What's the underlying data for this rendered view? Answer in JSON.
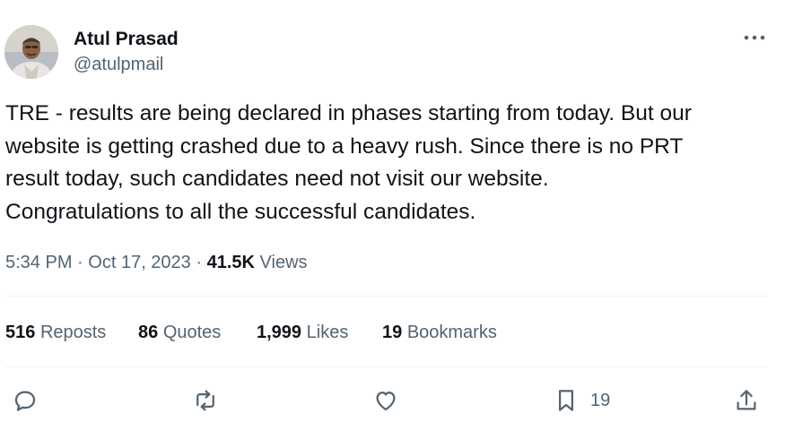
{
  "author": {
    "display_name": "Atul Prasad",
    "handle": "@atulpmail",
    "avatar_icon": "user-photo"
  },
  "tweet": {
    "text": "TRE - results are being declared in phases starting from today. But our\nwebsite is getting crashed due to a heavy rush. Since there is no PRT\nresult today, such candidates need not visit our website.\nCongratulations to all the successful candidates."
  },
  "meta": {
    "time": "5:34 PM",
    "separator": "·",
    "date": "Oct 17, 2023",
    "views_count": "41.5K",
    "views_label": "Views"
  },
  "stats": {
    "reposts": {
      "count": "516",
      "label": "Reposts"
    },
    "quotes": {
      "count": "86",
      "label": "Quotes"
    },
    "likes": {
      "count": "1,999",
      "label": "Likes"
    },
    "bookmarks": {
      "count": "19",
      "label": "Bookmarks"
    }
  },
  "actions": {
    "reply_icon": "reply-icon",
    "repost_icon": "repost-icon",
    "like_icon": "heart-icon",
    "bookmark_icon": "bookmark-icon",
    "bookmark_count": "19",
    "share_icon": "share-icon"
  },
  "colors": {
    "text_primary": "#0f1419",
    "text_secondary": "#536471",
    "divider": "#eff3f4"
  }
}
